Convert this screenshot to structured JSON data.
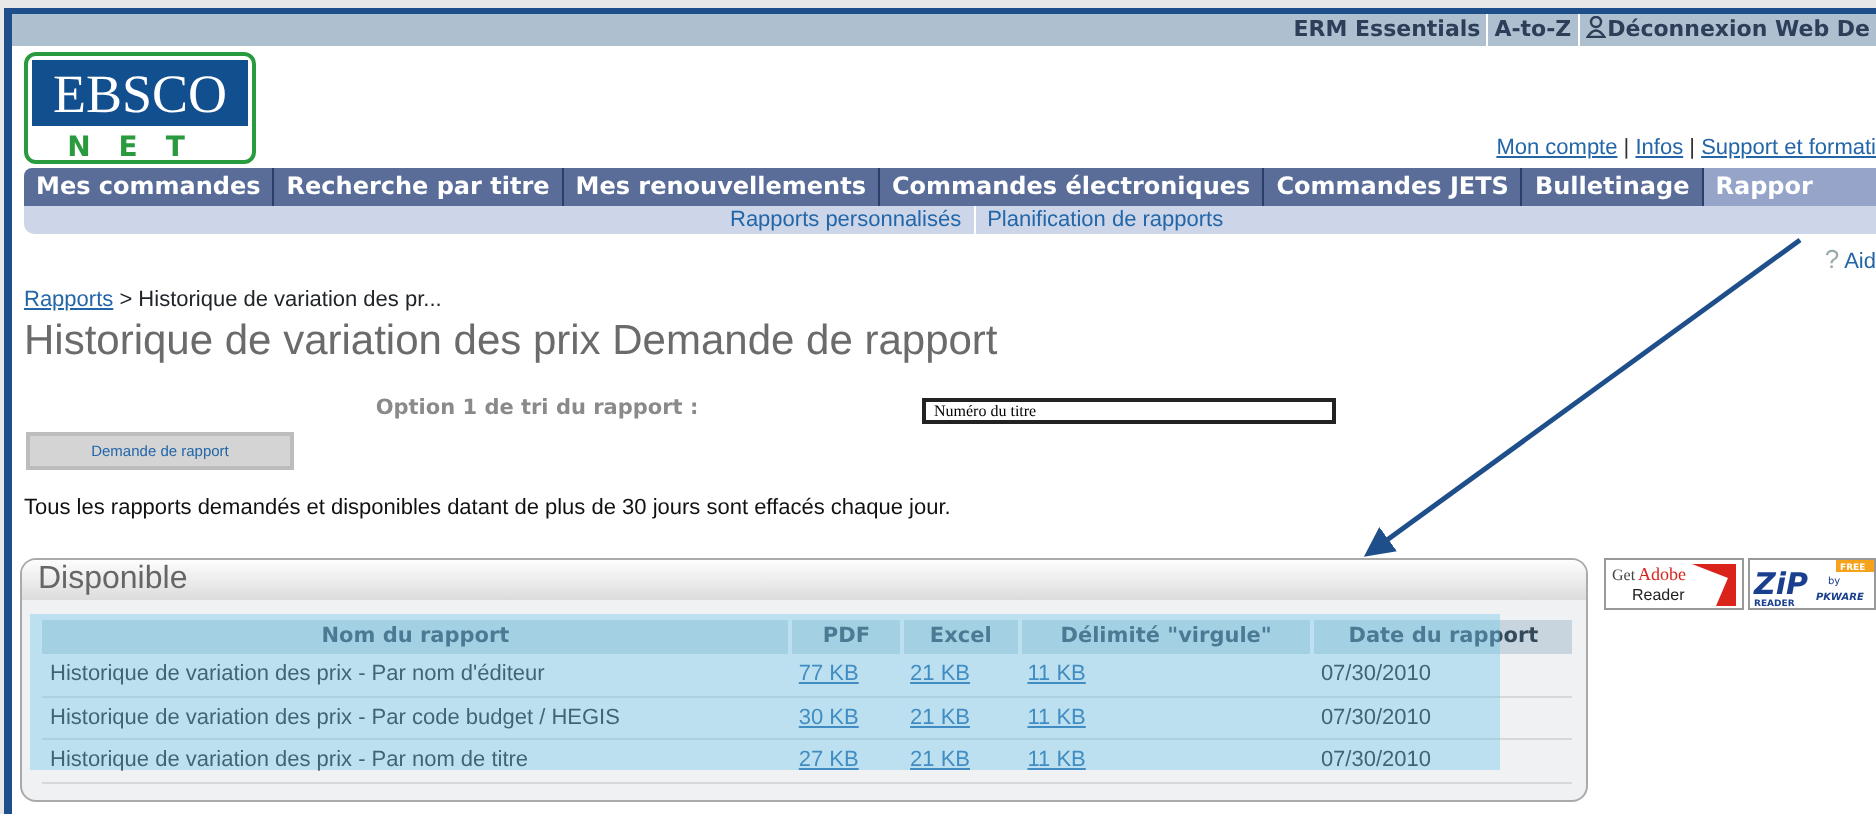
{
  "top_links": [
    {
      "label": "ERM Essentials",
      "kind": "text"
    },
    {
      "label": "A-to-Z",
      "kind": "text"
    },
    {
      "label": "Déconnexion Web De",
      "kind": "user"
    }
  ],
  "logo": {
    "top": "EBSCO",
    "bottom": "NET"
  },
  "account_links": [
    "Mon compte",
    "Infos",
    "Support et formati"
  ],
  "account_separator": "|",
  "nav": [
    {
      "label": "Mes commandes",
      "selected": false
    },
    {
      "label": "Recherche par titre",
      "selected": false
    },
    {
      "label": "Mes renouvellements",
      "selected": false
    },
    {
      "label": "Commandes électroniques",
      "selected": false
    },
    {
      "label": "Commandes JETS",
      "selected": false
    },
    {
      "label": "Bulletinage",
      "selected": false
    },
    {
      "label": "Rappor",
      "selected": true
    }
  ],
  "subnav": [
    "Rapports personnalisés",
    "Planification de rapports"
  ],
  "help_icon": "?",
  "help": "Aid",
  "breadcrumb": {
    "link": "Rapports",
    "current": "> Historique de variation des pr..."
  },
  "title": "Historique de variation des prix Demande de rapport",
  "sort_option": {
    "label": "Option 1 de tri du rapport :",
    "value": "Numéro du titre"
  },
  "request_button": "Demande de rapport",
  "notice": "Tous les rapports demandés et disponibles datant de plus de 30 jours sont effacés chaque jour.",
  "adobe_badge": {
    "get": "Get",
    "brand": "Adobe",
    "product": "Reader"
  },
  "zip_badge": {
    "name": "ZiP",
    "sub": "READER",
    "free": "FREE",
    "by": "by",
    "maker": "PKWARE"
  },
  "panel": {
    "title": "Disponible",
    "table": {
      "columns": [
        "Nom du rapport",
        "PDF",
        "Excel",
        "Délimité \"virgule\"",
        "Date du rapport"
      ],
      "rows": [
        [
          "Historique de variation des prix - Par nom d'éditeur",
          "77 KB",
          "21 KB",
          "11 KB",
          "07/30/2010"
        ],
        [
          "Historique de variation des prix - Par code budget / HEGIS",
          "30 KB",
          "21 KB",
          "11 KB",
          "07/30/2010"
        ],
        [
          "Historique de variation des prix - Par nom de titre",
          "27 KB",
          "21 KB",
          "11 KB",
          "07/30/2010"
        ]
      ]
    }
  }
}
